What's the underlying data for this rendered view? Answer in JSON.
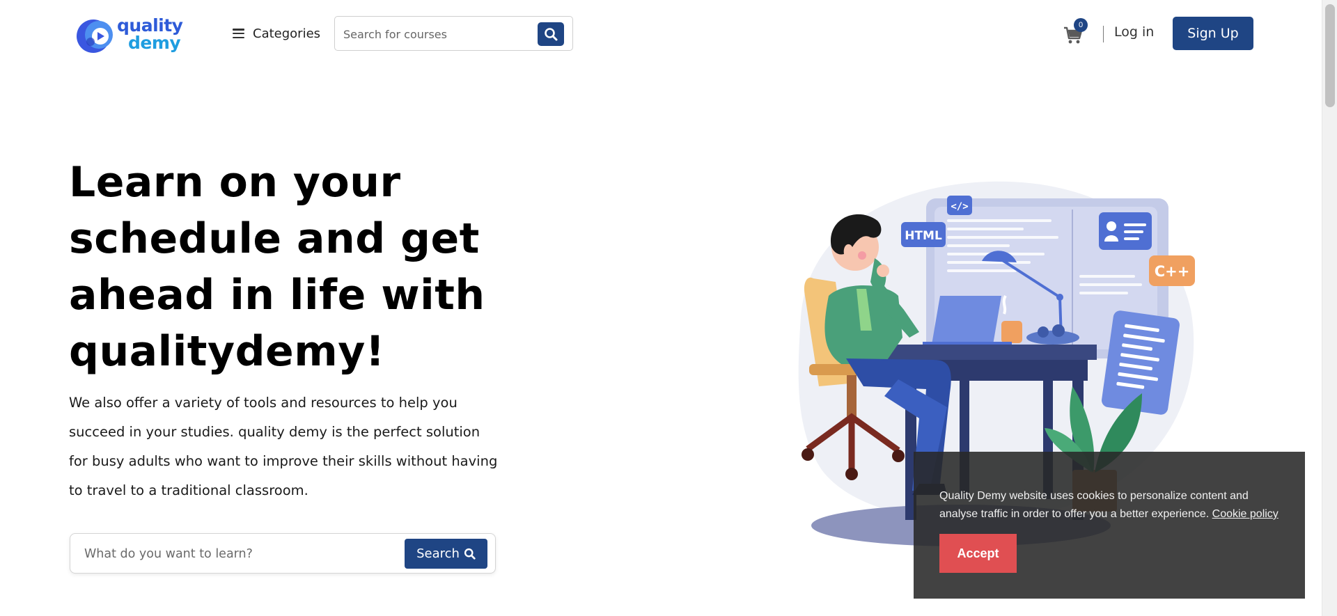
{
  "header": {
    "logo": {
      "line1": "quality",
      "line2": "demy"
    },
    "categories_label": "Categories",
    "search_placeholder": "Search for courses",
    "cart_count": "0",
    "login_label": "Log in",
    "signup_label": "Sign Up"
  },
  "hero": {
    "title": "Learn on your schedule and get ahead in life with qualitydemy!",
    "description": "We also offer a variety of tools and resources to help you succeed in your studies. quality demy is the perfect solution for busy adults who want to improve their skills without having to travel to a traditional classroom.",
    "search_placeholder": "What do you want to learn?",
    "search_button_label": "Search"
  },
  "illustration": {
    "tag_html": "HTML",
    "tag_code": "</>",
    "tag_cpp": "C++"
  },
  "cookie": {
    "text": "Quality Demy website uses cookies to personalize content and analyse traffic in order to offer you a better experience.",
    "link_label": "Cookie policy",
    "accept_label": "Accept"
  },
  "colors": {
    "primary": "#1f4584",
    "accept": "#e04f52",
    "logo_blue": "#2e5bd8"
  },
  "icons": {
    "menu": "hamburger-icon",
    "search": "search-icon",
    "cart": "cart-icon"
  }
}
